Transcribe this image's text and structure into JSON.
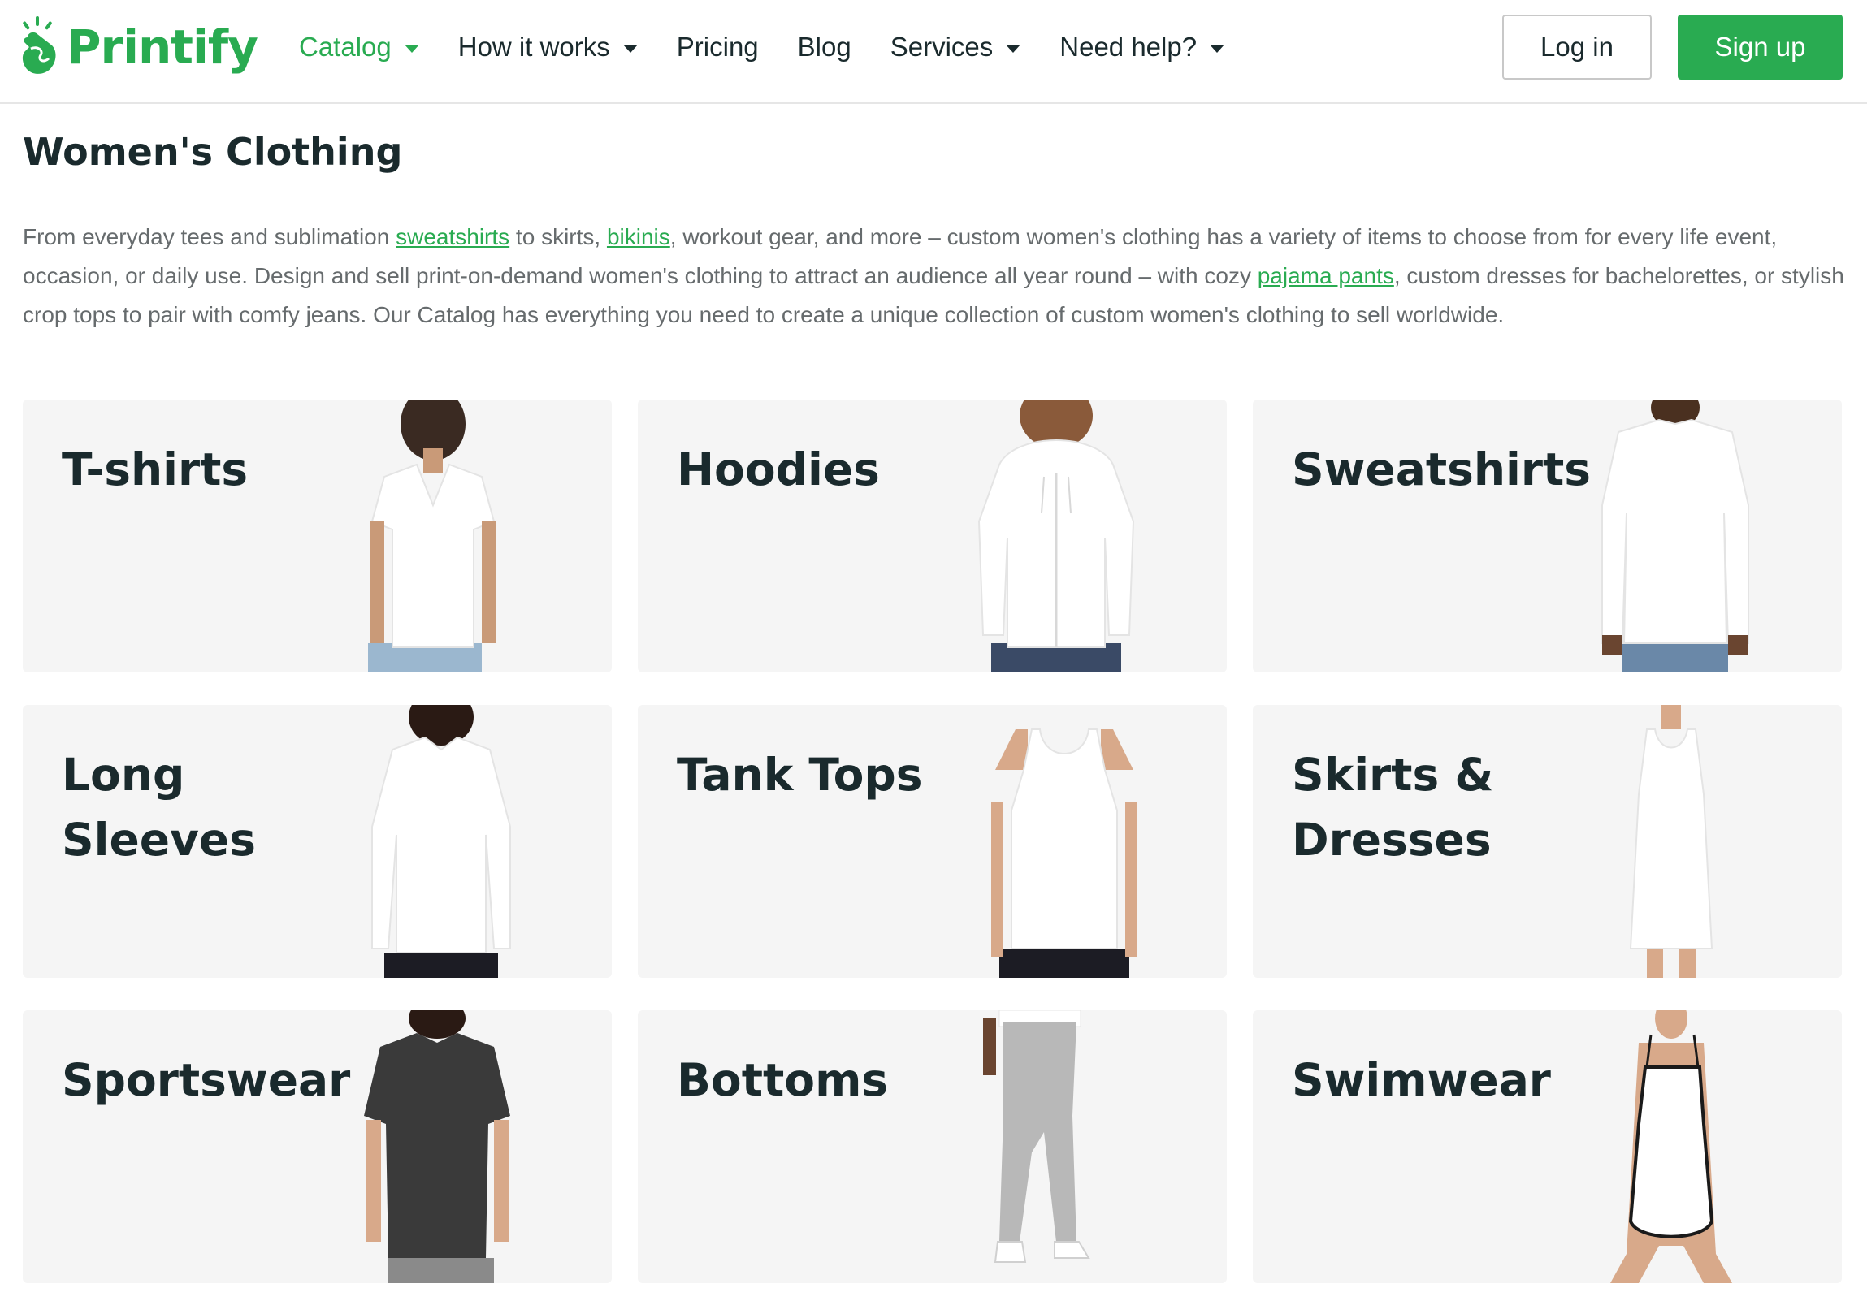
{
  "header": {
    "logo_text": "Printify",
    "nav": [
      {
        "label": "Catalog",
        "dropdown": true,
        "active": true
      },
      {
        "label": "How it works",
        "dropdown": true,
        "active": false
      },
      {
        "label": "Pricing",
        "dropdown": false,
        "active": false
      },
      {
        "label": "Blog",
        "dropdown": false,
        "active": false
      },
      {
        "label": "Services",
        "dropdown": true,
        "active": false
      },
      {
        "label": "Need help?",
        "dropdown": true,
        "active": false
      }
    ],
    "login_label": "Log in",
    "signup_label": "Sign up"
  },
  "main": {
    "title": "Women's Clothing",
    "intro": {
      "p1": "From everyday tees and sublimation ",
      "link_sweatshirts": "sweatshirts",
      "p2": " to skirts, ",
      "link_bikinis": "bikinis",
      "p3": ", workout gear, and more – custom women's clothing has a variety of items to choose from for every life event, occasion, or daily use. Design and sell print-on-demand women's clothing to attract an audience all year round – with cozy ",
      "link_pajama": "pajama pants",
      "p4": ", custom dresses for bachelorettes, or stylish crop tops to pair with comfy jeans. Our Catalog has everything you need to create a unique collection of custom women's clothing to sell worldwide."
    },
    "categories": [
      {
        "label": "T-shirts",
        "icon": "t-shirt-product-icon"
      },
      {
        "label": "Hoodies",
        "icon": "hoodie-product-icon"
      },
      {
        "label": "Sweatshirts",
        "icon": "sweatshirt-product-icon"
      },
      {
        "label": "Long Sleeves",
        "icon": "long-sleeve-product-icon"
      },
      {
        "label": "Tank Tops",
        "icon": "tank-top-product-icon"
      },
      {
        "label": "Skirts & Dresses",
        "icon": "dress-product-icon"
      },
      {
        "label": "Sportswear",
        "icon": "sportswear-product-icon"
      },
      {
        "label": "Bottoms",
        "icon": "bottoms-product-icon"
      },
      {
        "label": "Swimwear",
        "icon": "swimwear-product-icon"
      }
    ]
  },
  "colors": {
    "brand_green": "#29ab51",
    "text_dark": "#1a2a2d",
    "text_muted": "#666b6d",
    "card_bg": "#f5f5f5"
  }
}
